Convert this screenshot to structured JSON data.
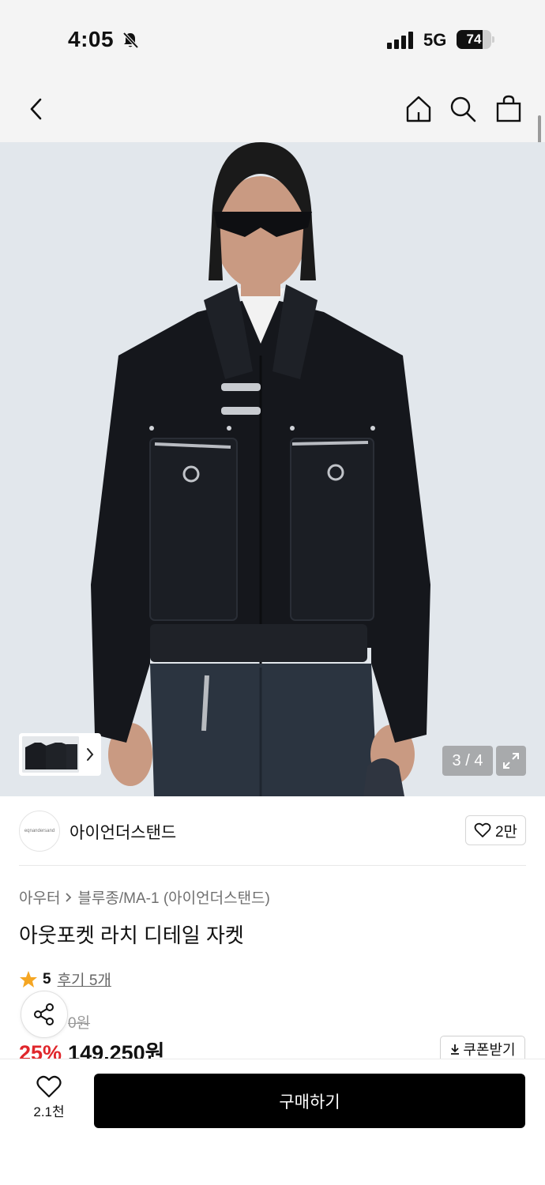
{
  "status_bar": {
    "time": "4:05",
    "network": "5G",
    "battery": "74",
    "battery_level": 0.74,
    "icons": [
      "bell-slash-icon",
      "signal-icon",
      "battery-icon"
    ]
  },
  "nav": {
    "icons": [
      "back-icon",
      "home-icon",
      "search-icon",
      "shopping-bag-icon"
    ]
  },
  "gallery": {
    "page_indicator": "3 / 4",
    "icons": [
      "chevron-right-icon",
      "expand-icon"
    ]
  },
  "brand": {
    "logo_text": "eqnandersand",
    "name": "아이언더스탠드",
    "like_count": "2만"
  },
  "breadcrumb": {
    "category": "아우터",
    "subcategory": "블루종/MA-1 (아이언더스탠드)"
  },
  "product": {
    "title": "아웃포켓 라치 디테일 자켓",
    "rating": "5",
    "review_label": "후기 5개",
    "original_price": "0원",
    "discount_rate": "25%",
    "sale_price": "149,250원",
    "coupon_label": "쿠폰받기"
  },
  "bottom_bar": {
    "wish_count": "2.1천",
    "buy_label": "구매하기"
  },
  "colors": {
    "accent_red": "#e0262b",
    "buy_button": "#000000",
    "star": "#f5a623",
    "hero_background": "#e2e7ec"
  }
}
